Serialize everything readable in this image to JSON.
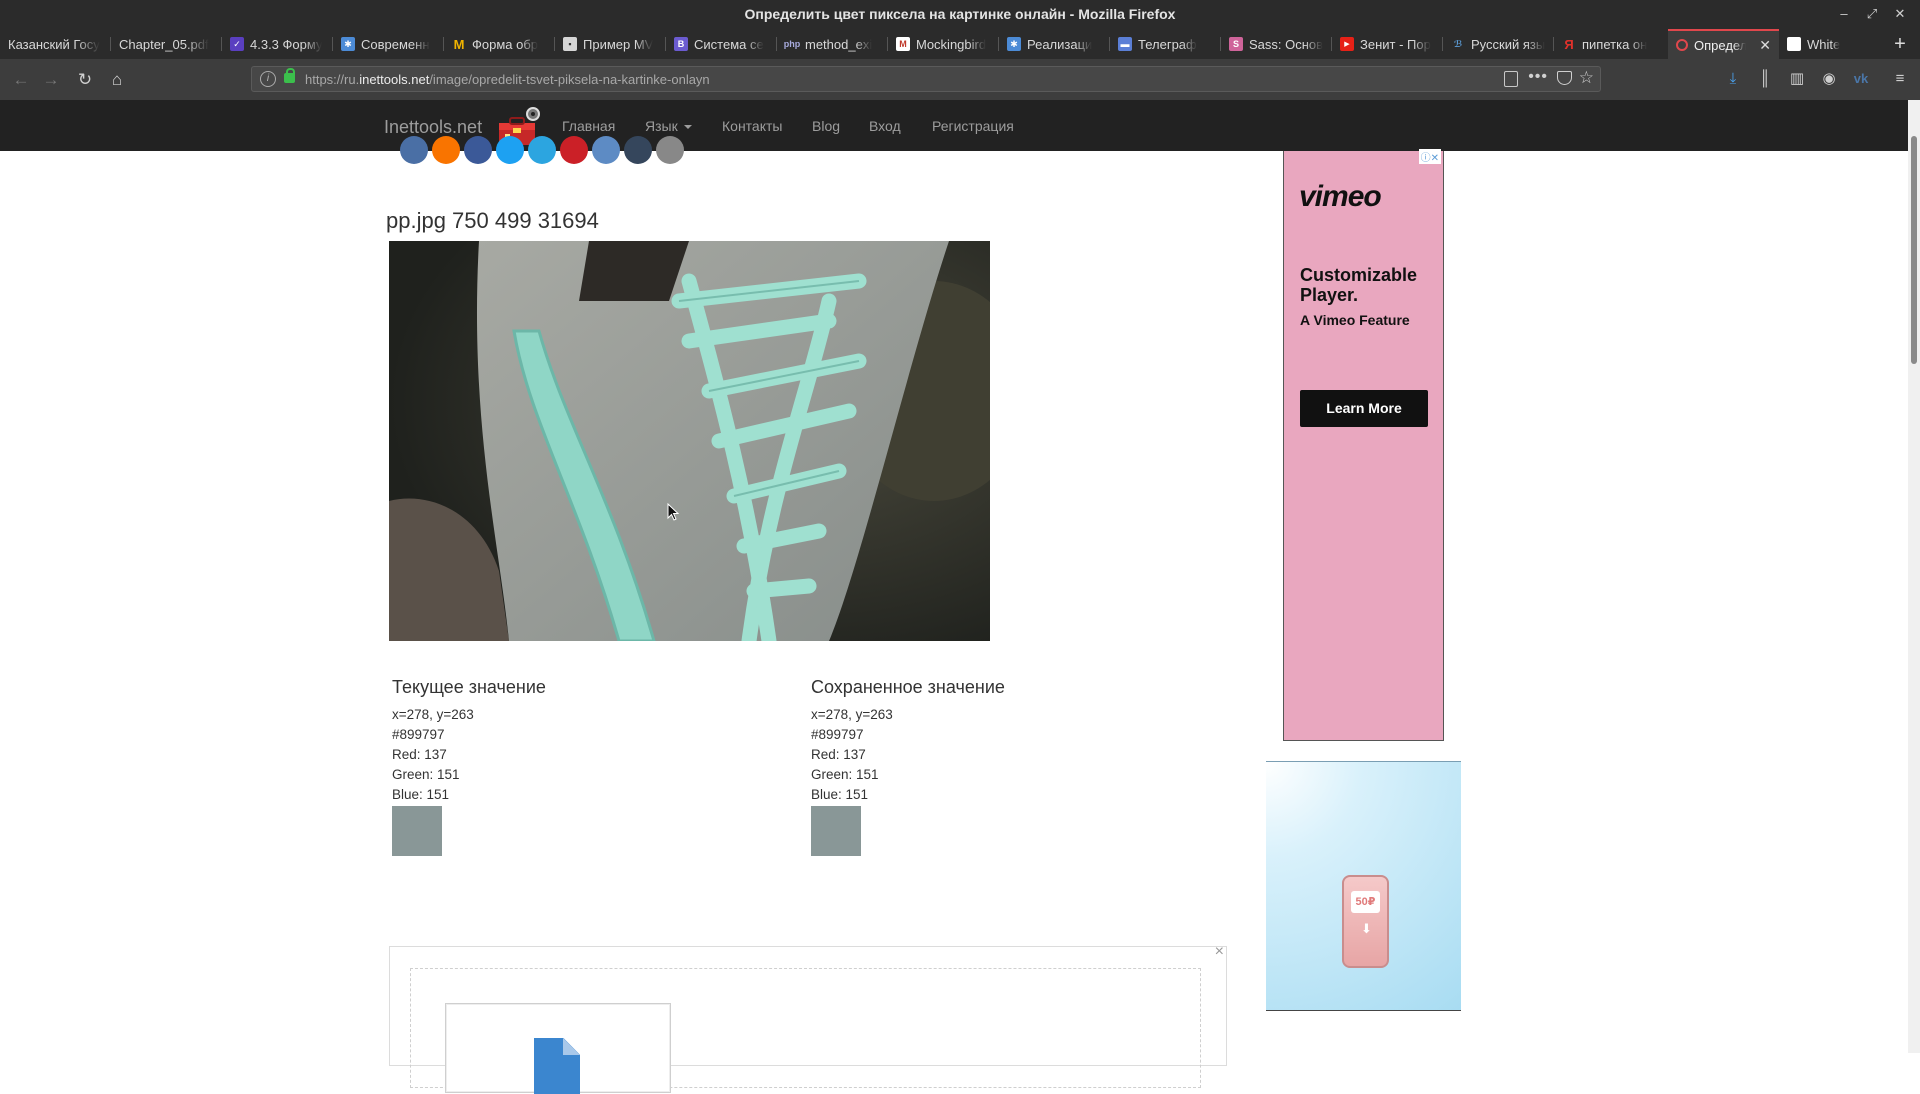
{
  "window": {
    "title": "Определить цвет пиксела на картинке онлайн - Mozilla Firefox"
  },
  "tabs": [
    {
      "label": "Казанский Госу",
      "color": "#2b2b2b"
    },
    {
      "label": "Chapter_05.pdf",
      "color": "#2b2b2b"
    },
    {
      "label": "4.3.3 Форму",
      "color": "#5a3fc0"
    },
    {
      "label": "Современн",
      "color": "#4c8bd6"
    },
    {
      "label": "Форма обр",
      "color": "#f0b400"
    },
    {
      "label": "Пример MV",
      "color": "#d6d6d6"
    },
    {
      "label": "Система се",
      "color": "#6b5bd0"
    },
    {
      "label": "method_exi",
      "color": "#7b7fb5"
    },
    {
      "label": "Mockingbird",
      "color": "#c0392b"
    },
    {
      "label": "Реализаци",
      "color": "#4c8bd6"
    },
    {
      "label": "Телеграф",
      "color": "#5b7fd6"
    },
    {
      "label": "Sass: Основ",
      "color": "#cf649a"
    },
    {
      "label": "Зенит - Пор",
      "color": "#e62117"
    },
    {
      "label": "Русский язы",
      "color": "#2a6fd6"
    },
    {
      "label": "пипетка он",
      "color": "#e0312b"
    },
    {
      "label": "Определ",
      "color": "#e0474c",
      "active": true
    },
    {
      "label": "White",
      "color": "#ffffff"
    }
  ],
  "address": {
    "url_prefix": "https://ru.",
    "url_domain": "inettools.net",
    "url_path": "/image/opredelit-tsvet-piksela-na-kartinke-onlayn"
  },
  "site": {
    "brand": "Inettools.net",
    "nav": {
      "home": "Главная",
      "language": "Язык",
      "contacts": "Контакты",
      "blog": "Blog",
      "login": "Вход",
      "register": "Регистрация"
    }
  },
  "share_colors": [
    "#4a6fa5",
    "#f97400",
    "#3b5998",
    "#1da1f2",
    "#2ca5e0",
    "#cb2027",
    "#5d8bc4",
    "#35465c",
    "#888888"
  ],
  "image": {
    "heading": "pp.jpg 750 499 31694"
  },
  "current": {
    "title": "Текущее значение",
    "coords": "x=278, y=263",
    "hex": "#899797",
    "red": "Red: 137",
    "green": "Green: 151",
    "blue": "Blue: 151",
    "swatch_color": "#899797"
  },
  "saved": {
    "title": "Сохраненное значение",
    "coords": "x=278, y=263",
    "hex": "#899797",
    "red": "Red: 137",
    "green": "Green: 151",
    "blue": "Blue: 151",
    "swatch_color": "#899797"
  },
  "ads": {
    "vimeo": {
      "logo": "vimeo",
      "headline_line1": "Customizable",
      "headline_line2": "Player.",
      "sub": "A Vimeo Feature",
      "cta": "Learn More",
      "bg": "#e9a7bf"
    },
    "phone": {
      "screen": "50₽"
    }
  }
}
